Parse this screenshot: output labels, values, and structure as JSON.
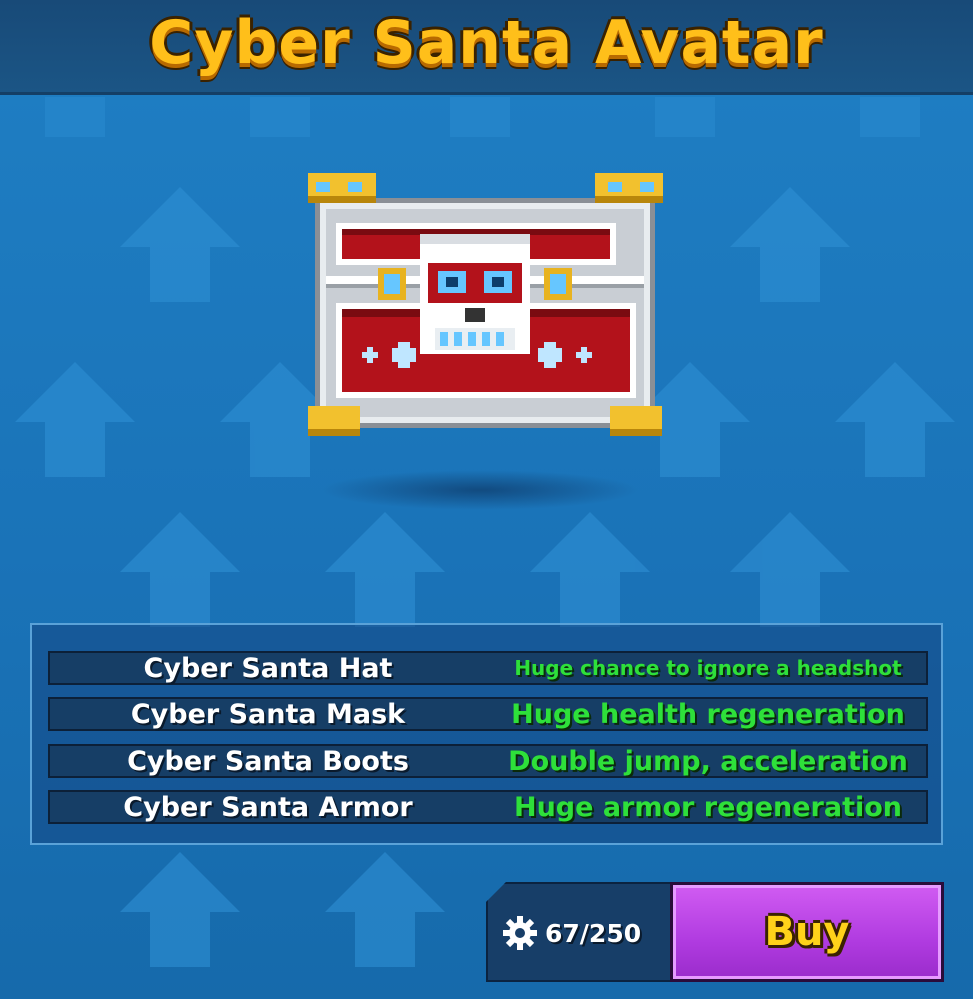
{
  "header": {
    "title": "Cyber Santa Avatar"
  },
  "items": [
    {
      "name": "Cyber Santa Hat",
      "perk": "Huge chance to ignore a headshot"
    },
    {
      "name": "Cyber Santa Mask",
      "perk": "Huge health regeneration"
    },
    {
      "name": "Cyber Santa Boots",
      "perk": "Double jump, acceleration"
    },
    {
      "name": "Cyber Santa Armor",
      "perk": "Huge armor regeneration"
    }
  ],
  "purchase": {
    "progress": "67/250",
    "buy_label": "Buy",
    "progress_icon": "gear-icon"
  },
  "colors": {
    "title": "#ffbf1a",
    "perk_text": "#2ee03a",
    "buy_button": "#b03be0",
    "buy_text": "#ffd21a",
    "background": "#1a73b8"
  }
}
